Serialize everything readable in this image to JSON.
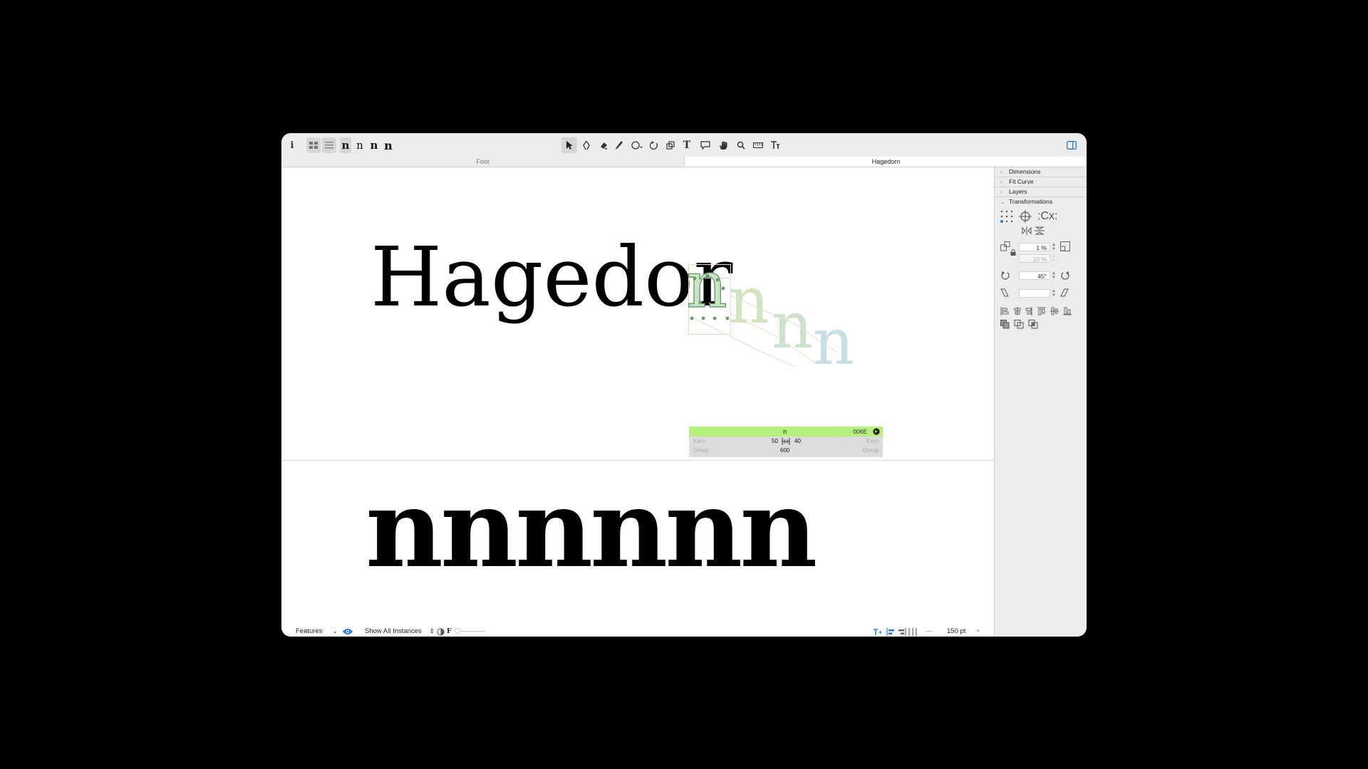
{
  "toolbar": {
    "info_icon": "i",
    "view_buttons": [
      "grid-view-icon",
      "list-view-icon"
    ],
    "weight_glyphs": [
      "n",
      "n",
      "n",
      "n"
    ],
    "tools": [
      "select-tool-icon",
      "pen-tool-icon",
      "eraser-tool-icon",
      "pencil-tool-icon",
      "shape-tool-icon",
      "rotate-tool-icon",
      "scale-tool-icon",
      "text-tool-icon",
      "annotation-tool-icon",
      "hand-tool-icon",
      "zoom-tool-icon",
      "measure-tool-icon",
      "text-metrics-tool-icon"
    ],
    "sidebar_toggle_icon": "sidebar-toggle-icon"
  },
  "tabs": {
    "font": "Font",
    "hagedorn": "Hagedorn"
  },
  "canvas": {
    "edit_text": "Hagedor",
    "active_glyph": "n",
    "interpolation_glyphs": [
      "n",
      "n",
      "n"
    ],
    "preview_text": "nnnnnn"
  },
  "kern_box": {
    "glyph_name": "n",
    "unicode": "006E",
    "kern_left_label": "Kern",
    "kern_right_label": "Kern",
    "left_sidebearing": "50",
    "right_sidebearing": "40",
    "group_left_label": "Group",
    "group_right_label": "Group",
    "width": "600",
    "accent_color": "#b5ef7d"
  },
  "sidebar": {
    "sections": [
      {
        "label": "Dimensions",
        "expanded": false
      },
      {
        "label": "Fit Curve",
        "expanded": false
      },
      {
        "label": "Layers",
        "expanded": false
      },
      {
        "label": "Transformations",
        "expanded": true
      }
    ],
    "scale_value": "1 %",
    "scale_value_2": "10 %",
    "rotate_value": "45°",
    "slant_value": ""
  },
  "statusbar": {
    "features_label": "Features",
    "show_instances_label": "Show All Instances",
    "f_glyph": "F",
    "zoom_value": "150 pt",
    "zoom_minus": "—",
    "zoom_plus": "+"
  },
  "colors": {
    "green_layer": "#c9dfb5",
    "blue_layer": "#bcdae0",
    "accent_blue": "#1f7ae0"
  }
}
